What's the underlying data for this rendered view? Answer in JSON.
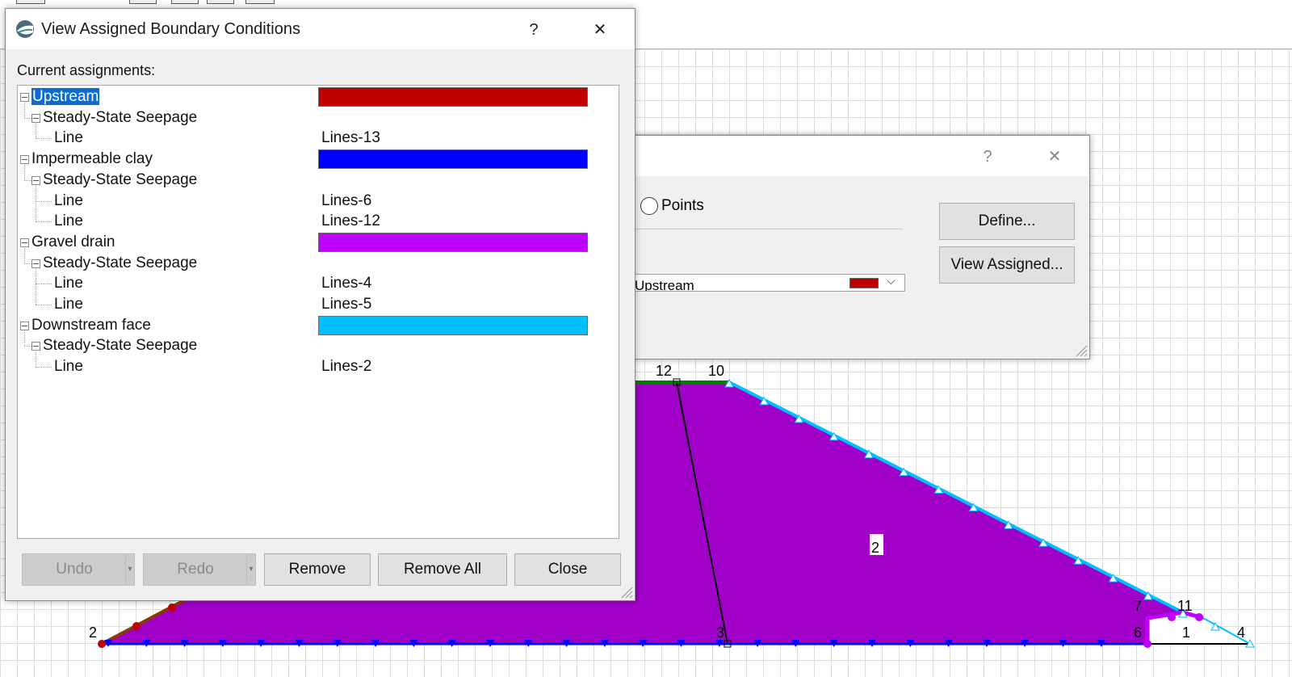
{
  "dialog_main": {
    "title": "View Assigned Boundary Conditions",
    "help": "?",
    "close_glyph": "✕",
    "current_label": "Current assignments:",
    "tree": [
      {
        "label": "Upstream",
        "color": "#c00000",
        "selected": true,
        "children": [
          {
            "label": "Steady-State Seepage",
            "children": [
              {
                "label": "Line",
                "value": "Lines-13"
              }
            ]
          }
        ]
      },
      {
        "label": "Impermeable clay",
        "color": "#0000ff",
        "children": [
          {
            "label": "Steady-State Seepage",
            "children": [
              {
                "label": "Line",
                "value": "Lines-6"
              },
              {
                "label": "Line",
                "value": "Lines-12"
              }
            ]
          }
        ]
      },
      {
        "label": "Gravel drain",
        "color": "#bf00ff",
        "children": [
          {
            "label": "Steady-State Seepage",
            "children": [
              {
                "label": "Line",
                "value": "Lines-4"
              },
              {
                "label": "Line",
                "value": "Lines-5"
              }
            ]
          }
        ]
      },
      {
        "label": "Downstream face",
        "color": "#00bfff",
        "children": [
          {
            "label": "Steady-State Seepage",
            "children": [
              {
                "label": "Line",
                "value": "Lines-2"
              }
            ]
          }
        ]
      }
    ],
    "buttons": {
      "undo": "Undo",
      "redo": "Redo",
      "remove": "Remove",
      "remove_all": "Remove All",
      "close": "Close"
    }
  },
  "dialog_back": {
    "help": "?",
    "close_glyph": "✕",
    "radio_points": "Points",
    "combo_value": "Upstream",
    "combo_color": "#c00000",
    "define_button": "Define...",
    "view_assigned_button": "View Assigned..."
  },
  "model": {
    "region_labels": {
      "r1": "1",
      "r2": "2"
    },
    "point_labels": {
      "p2": "2",
      "p3": "3",
      "p4": "4",
      "p6": "6",
      "p7": "7",
      "p10": "10",
      "p11": "11",
      "p12": "12"
    },
    "colors": {
      "region_fill": "#a000c8",
      "clay_line": "#0000ff",
      "upstream_line": "#c00000",
      "downstream_line": "#00bfff",
      "crest_line": "#008000",
      "drain": "#bf00ff"
    }
  }
}
